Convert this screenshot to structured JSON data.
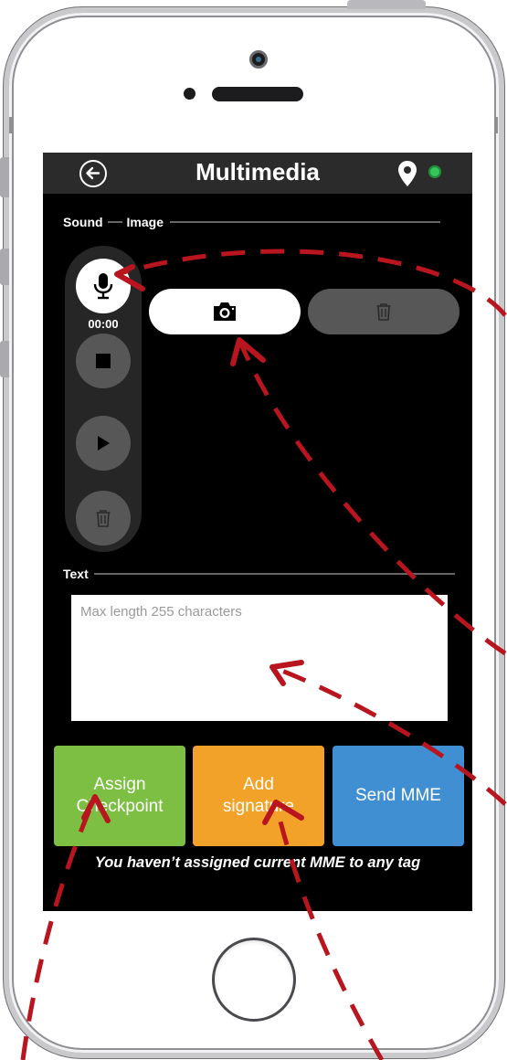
{
  "header": {
    "title": "Multimedia",
    "back_icon": "arrow-left-circle-icon",
    "location_icon": "map-pin-icon",
    "status_color": "#35c759"
  },
  "sections": {
    "sound_label": "Sound",
    "image_label": "Image",
    "text_label": "Text"
  },
  "sound": {
    "timer": "00:00",
    "record_icon": "microphone-icon",
    "stop_icon": "stop-icon",
    "play_icon": "play-icon",
    "delete_icon": "trash-icon"
  },
  "image": {
    "camera_icon": "camera-icon",
    "delete_icon": "trash-icon"
  },
  "text_input": {
    "value": "",
    "placeholder": "Max length 255 characters"
  },
  "actions": {
    "assign_label": "Assign Checkpoint",
    "signature_label": "Add signature",
    "send_label": "Send MME"
  },
  "colors": {
    "assign": "#7cbf43",
    "signature": "#f3a229",
    "send": "#3f8fd2",
    "annotation": "#b8151f"
  },
  "hint": "You haven’t assigned current MME to any tag"
}
